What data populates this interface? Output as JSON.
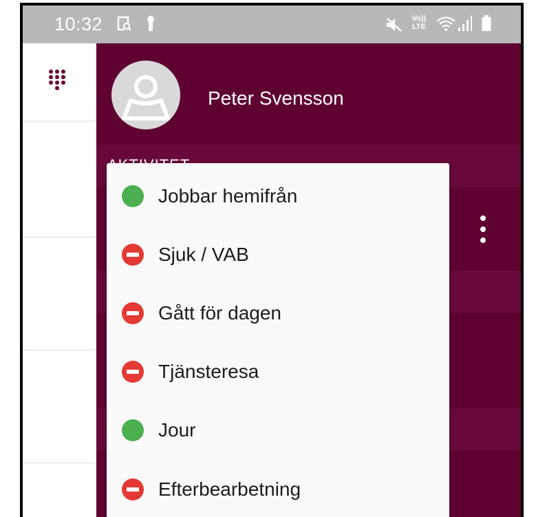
{
  "status_bar": {
    "time": "10:32",
    "left_icons": [
      "screenshot-icon",
      "lock-icon"
    ],
    "right_icons": [
      "mute-icon",
      "volte-icon",
      "wifi-icon",
      "signal-icon",
      "battery-icon"
    ],
    "volte_text": "Vo)) LTE"
  },
  "profile": {
    "name": "Peter Svensson"
  },
  "section": {
    "label": "AKTIVITET"
  },
  "status_menu": {
    "items": [
      {
        "label": "Jobbar hemifrån",
        "status": "available",
        "color": "#4caf50"
      },
      {
        "label": "Sjuk / VAB",
        "status": "unavailable",
        "color": "#e53935"
      },
      {
        "label": "Gått för dagen",
        "status": "unavailable",
        "color": "#e53935"
      },
      {
        "label": "Tjänsteresa",
        "status": "unavailable",
        "color": "#e53935"
      },
      {
        "label": "Jour",
        "status": "available",
        "color": "#4caf50"
      },
      {
        "label": "Efterbearbetning",
        "status": "unavailable",
        "color": "#e53935"
      }
    ]
  },
  "colors": {
    "brand": "#5e0030",
    "available": "#4caf50",
    "unavailable": "#e53935"
  }
}
